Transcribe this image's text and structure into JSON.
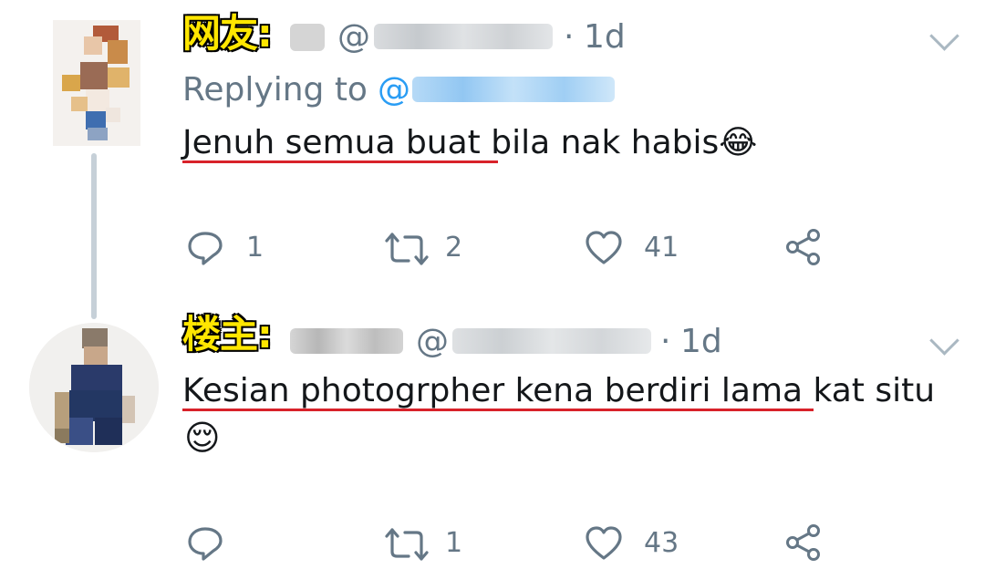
{
  "tweets": [
    {
      "tag": "网友:",
      "at_prefix": "@",
      "separator": "·",
      "time": "1d",
      "replying_label": "Replying to",
      "reply_at": "@",
      "text": "Jenuh semua buat bila nak habis",
      "emoji": "😂",
      "actions": {
        "replies": "1",
        "retweets": "2",
        "likes": "41"
      }
    },
    {
      "tag": "楼主:",
      "at_prefix": "@",
      "separator": "·",
      "time": "1d",
      "text": "Kesian photogrpher kena berdiri lama kat situ",
      "emoji": "😌",
      "actions": {
        "replies": "",
        "retweets": "1",
        "likes": "43"
      }
    }
  ],
  "icons": {
    "reply": "reply-icon",
    "retweet": "retweet-icon",
    "like": "heart-icon",
    "share": "share-icon",
    "more": "chevron-down-icon"
  },
  "colors": {
    "tag_fill": "#ffe600",
    "underline": "#d8222a",
    "link": "#2a9df4",
    "secondary": "#657786"
  }
}
